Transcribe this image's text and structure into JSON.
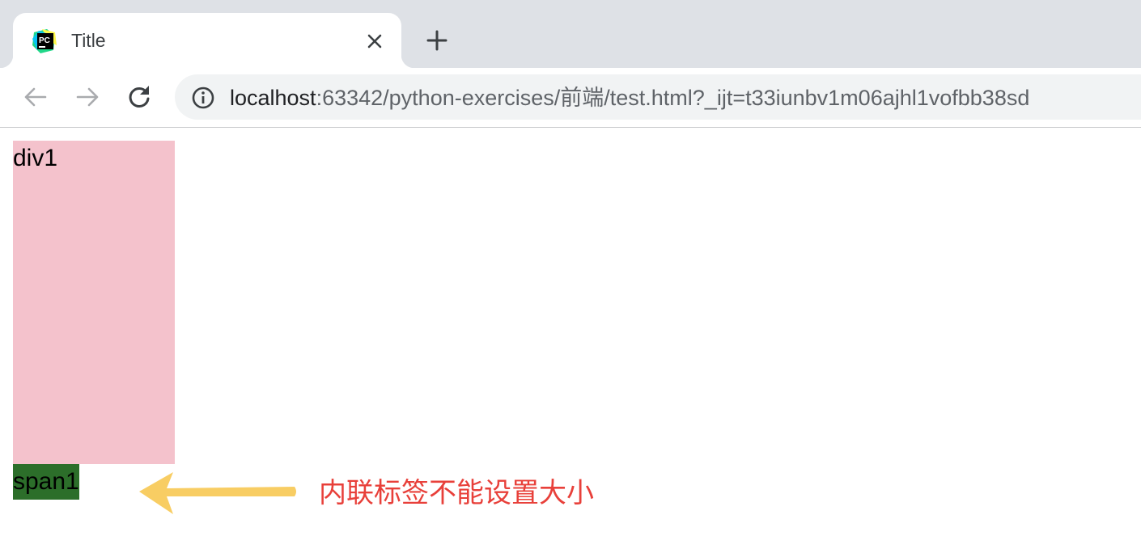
{
  "tab": {
    "title": "Title"
  },
  "address_bar": {
    "host": "localhost",
    "path": ":63342/python-exercises/前端/test.html?_ijt=t33iunbv1m06ajhl1vofbb38sd"
  },
  "page": {
    "div_text": "div1",
    "span_text": "span1",
    "annotation": "内联标签不能设置大小"
  },
  "colors": {
    "div_background": "#f4c2cc",
    "span_background": "#2c6e2a",
    "arrow": "#f8cd63",
    "annotation": "#e8403a"
  },
  "icons": [
    "pycharm-favicon",
    "close-icon",
    "plus-icon",
    "back-arrow-icon",
    "forward-arrow-icon",
    "reload-icon",
    "info-icon",
    "arrow-left-icon"
  ]
}
